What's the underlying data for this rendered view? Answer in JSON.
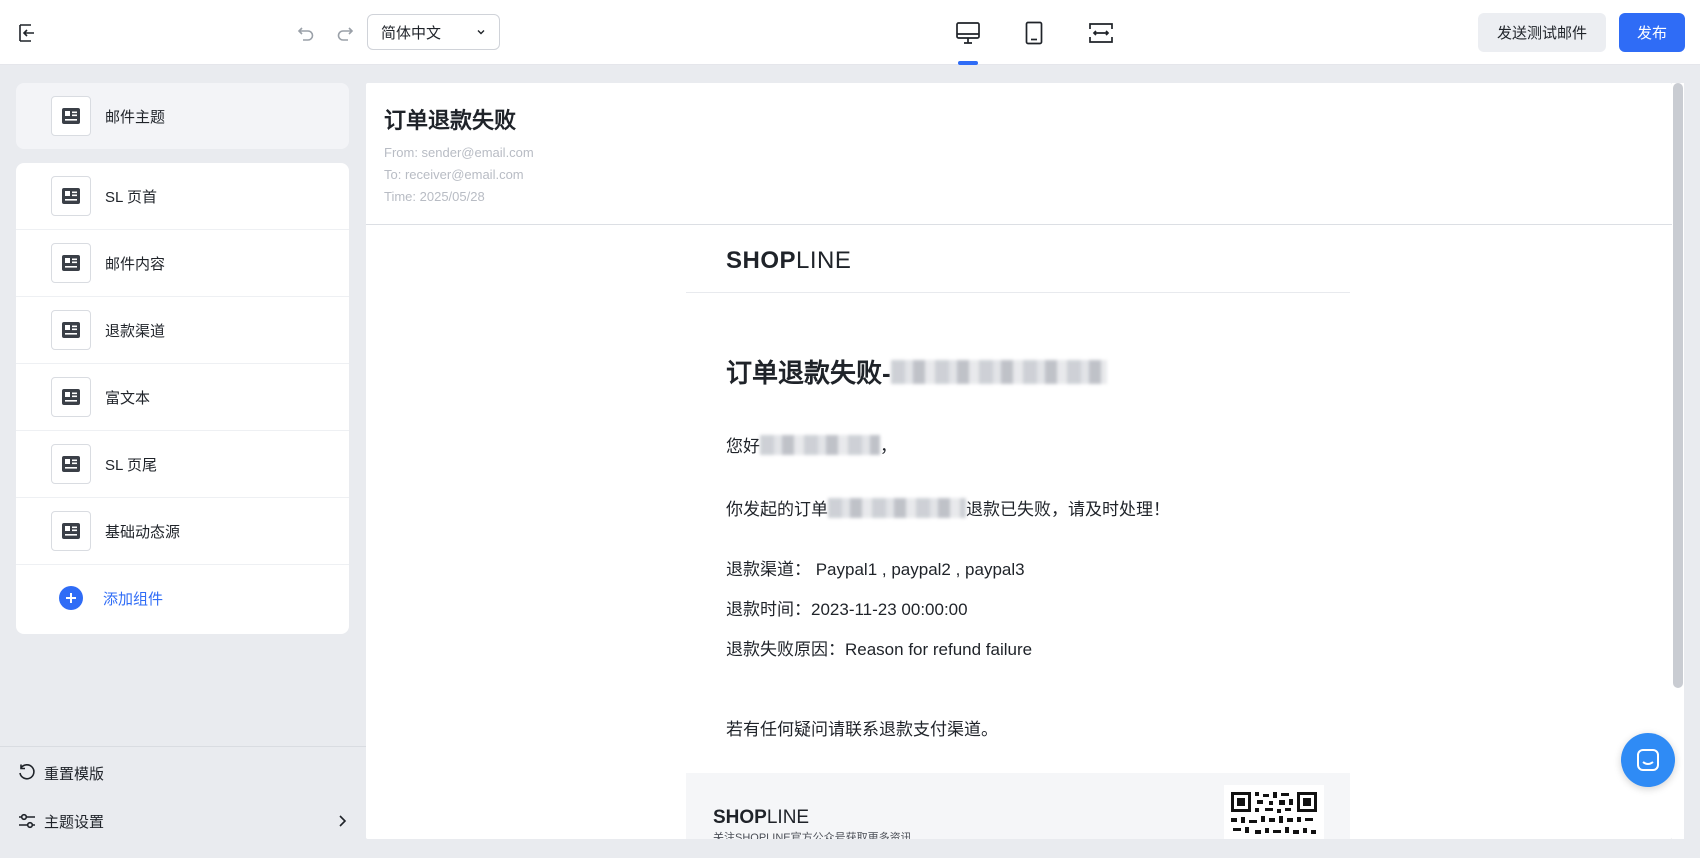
{
  "toolbar": {
    "language": "简体中文",
    "test_email_label": "发送测试邮件",
    "publish_label": "发布"
  },
  "sidebar": {
    "subject_item": "邮件主题",
    "items": [
      {
        "label": "SL 页首"
      },
      {
        "label": "邮件内容"
      },
      {
        "label": "退款渠道"
      },
      {
        "label": "富文本"
      },
      {
        "label": "SL 页尾"
      },
      {
        "label": "基础动态源"
      }
    ],
    "add_component": "添加组件",
    "reset_template": "重置模版",
    "theme_settings": "主题设置"
  },
  "preview": {
    "subject": "订单退款失败",
    "from": "From: sender@email.com",
    "to": "To: receiver@email.com",
    "time": "Time: 2025/05/28",
    "logo": {
      "bold": "SHOP",
      "thin": "LINE"
    },
    "title_prefix": "订单退款失败-",
    "greeting_prefix": "您好",
    "greeting_suffix": "，",
    "notice_prefix": "你发起的订单",
    "notice_suffix": "退款已失败，请及时处理！",
    "channel_line": "退款渠道： Paypal1 , paypal2 , paypal3",
    "time_line": "退款时间：2023-11-23 00:00:00",
    "reason_line": "退款失败原因：Reason for refund failure",
    "contact_line": "若有任何疑问请联系退款支付渠道。",
    "footer_logo": {
      "bold": "SHOP",
      "thin": "LINE"
    },
    "footer_sub": "关注SHOPLINE官方公众号获取更多资讯"
  },
  "colors": {
    "accent": "#2f6cf6",
    "chat": "#2f8bf5"
  }
}
